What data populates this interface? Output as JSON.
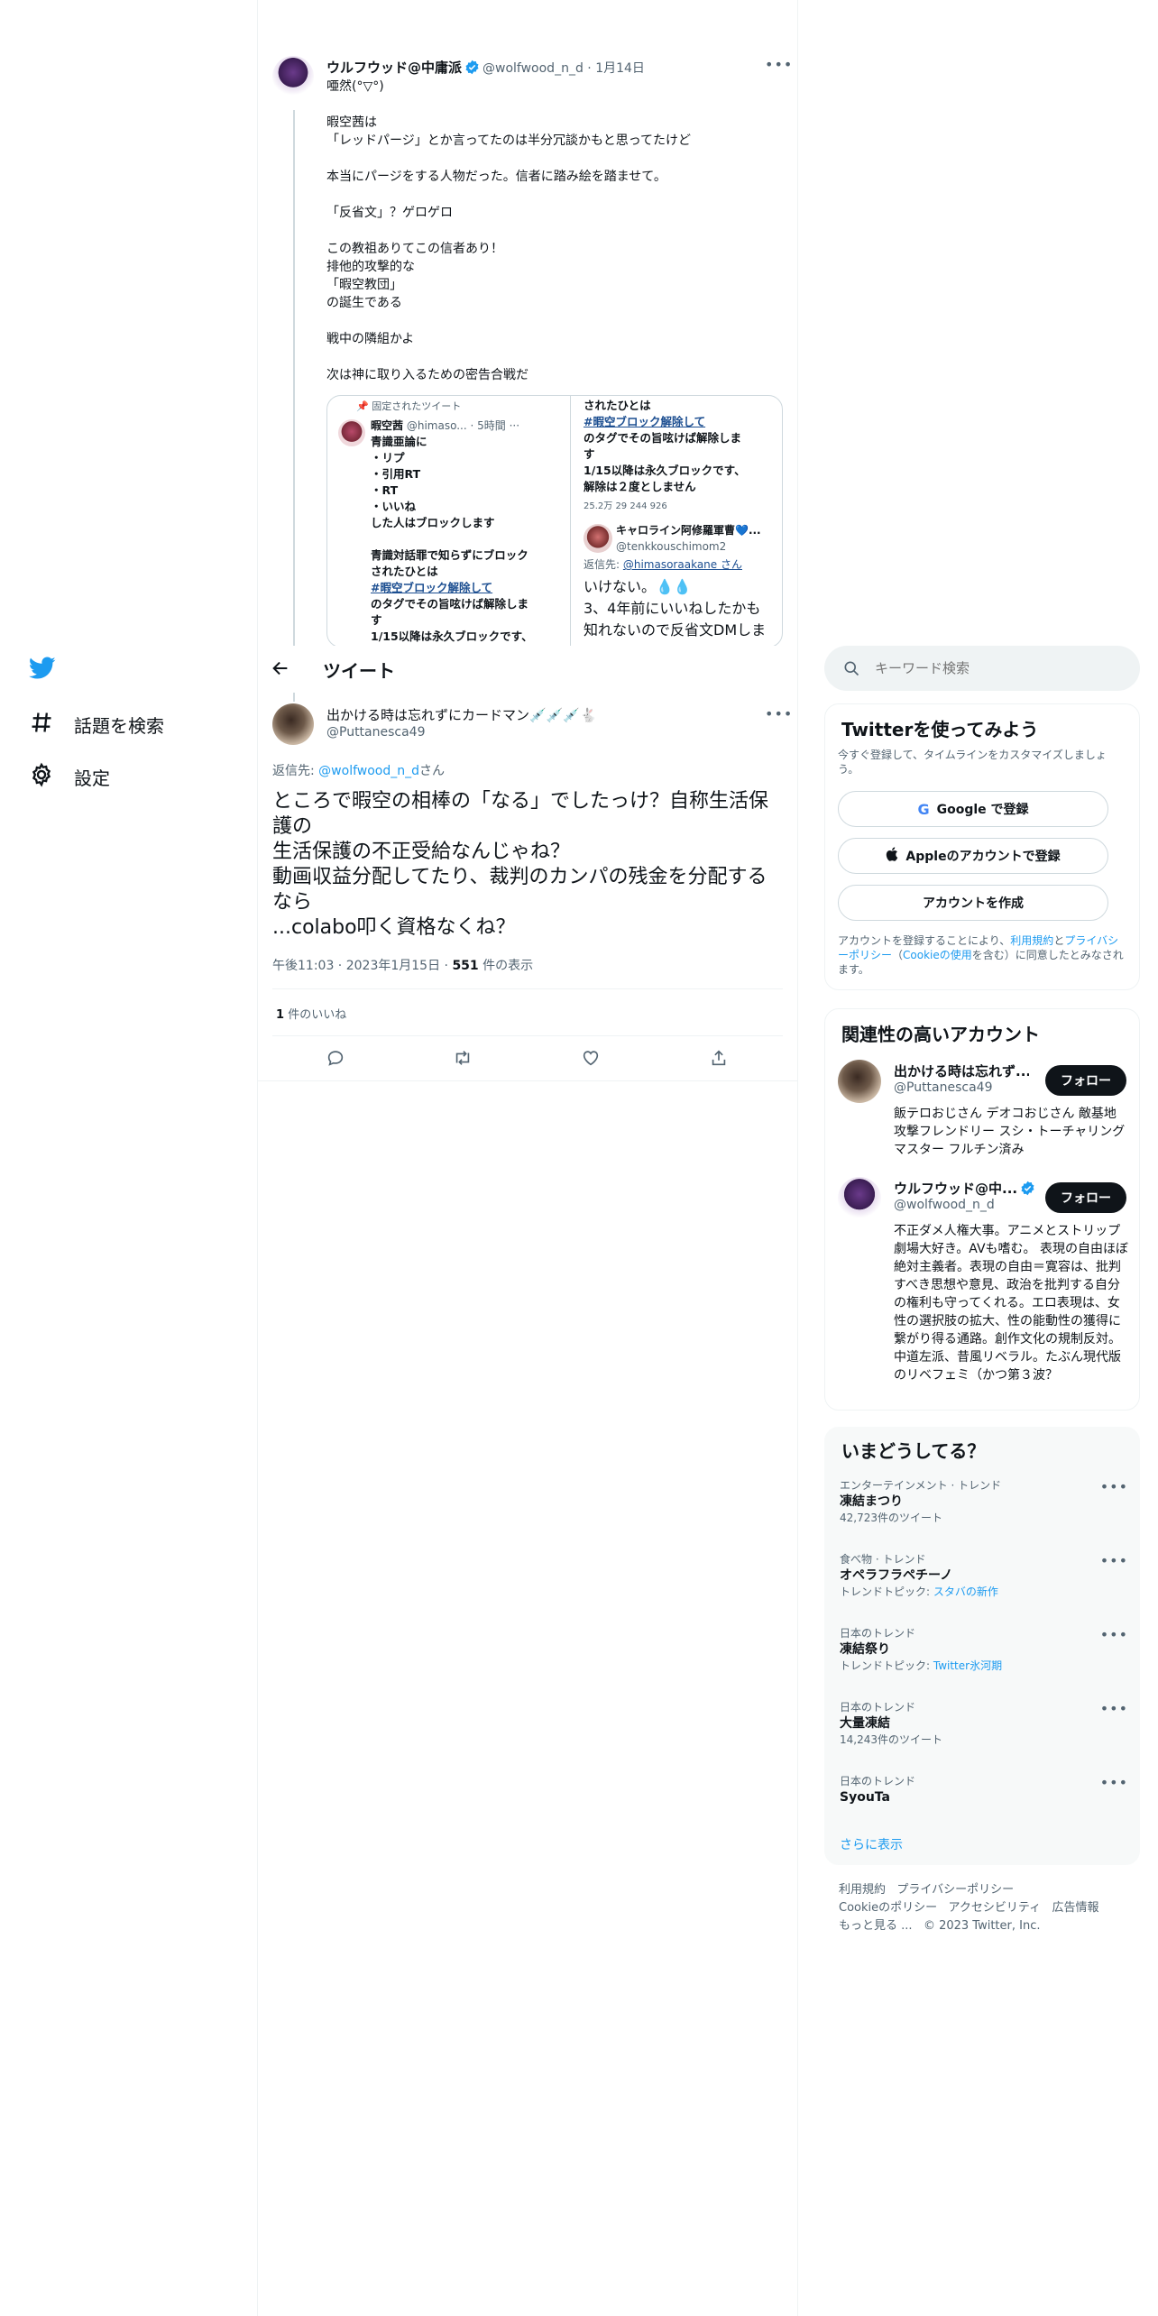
{
  "nav": {
    "explore_label": "話題を検索",
    "settings_label": "設定"
  },
  "parent_tweet": {
    "display_name": "ウルフウッド@中庸派",
    "handle": "@wolfwood_n_d",
    "date": "1月14日",
    "body": "唖然(°▽°)\n\n暇空茜は\n「レッドパージ」とか言ってたのは半分冗談かもと思ってたけど\n\n本当にパージをする人物だった。信者に踏み絵を踏ませて。\n\n「反省文」？ゲロゲロ\n\nこの教祖ありてこの信者あり！\n排他的攻撃的な\n「暇空教団」\nの誕生である\n\n戦中の隣組かよ\n\n次は神に取り入るための密告合戦だ",
    "media": {
      "pinned_label": "固定されたツイート",
      "left_name": "暇空茜",
      "left_handle": "@himaso...",
      "left_time": "5時間",
      "left_lines": [
        "青識亜論に",
        "・リプ",
        "・引用RT",
        "・RT",
        "・いいね",
        "した人はブロックします",
        "",
        "青識対話罪で知らずにブロック",
        "されたひとは"
      ],
      "left_hashtag": "#暇空ブロック解除して",
      "left_tail": [
        "のタグでその旨呟けば解除しま",
        "す",
        "1/15以降は永久ブロックです、"
      ],
      "right_top_lines": [
        "されたひとは"
      ],
      "right_hashtag": "#暇空ブロック解除して",
      "right_lines": [
        "のタグでその旨呟けば解除しま",
        "す",
        "1/15以降は永久ブロックです、",
        "解除は２度としません"
      ],
      "right_stats": "25.2万   29   244   926",
      "reply_name": "キャロライン阿修羅軍曹💙...",
      "reply_handle": "@tenkkouschimom2",
      "reply_to_prefix": "返信先: ",
      "reply_to_handle": "@himasoraakane さん",
      "reply_text_1": "いけない。💧💧",
      "reply_text_2": "3、4年前にいいねしたかも",
      "reply_text_3": "知れないので反省文DMしま"
    }
  },
  "header": {
    "title": "ツイート"
  },
  "main_tweet": {
    "display_name": "出かける時は忘れずにカードマン💉💉💉🐇",
    "handle": "@Puttanesca49",
    "reply_prefix": "返信先: ",
    "reply_handle": "@wolfwood_n_d",
    "reply_suffix": "さん",
    "body": "ところで暇空の相棒の「なる」でしたっけ？自称生活保護の\n生活保護の不正受給なんじゃね？\n動画収益分配してたり、裁判のカンパの残金を分配するなら\n...colabo叩く資格なくね？",
    "time": "午後11:03",
    "date": "2023年1月15日",
    "views_count": "551",
    "views_label": "件の表示",
    "likes_count": "1",
    "likes_label": "件のいいね"
  },
  "search": {
    "placeholder": "キーワード検索"
  },
  "signup": {
    "title": "Twitterを使ってみよう",
    "subtitle": "今すぐ登録して、タイムラインをカスタマイズしましょう。",
    "google_label": "Google で登録",
    "apple_label": "Appleのアカウントで登録",
    "create_label": "アカウントを作成",
    "legal_1": "アカウントを登録することにより、",
    "terms_link": "利用規約",
    "legal_2": "と",
    "privacy_link": "プライバシーポリシー",
    "legal_3": "（",
    "cookie_link": "Cookieの使用",
    "legal_4": "を含む）に同意したとみなされます。"
  },
  "related": {
    "title": "関連性の高いアカウント",
    "follow_label": "フォロー",
    "accounts": [
      {
        "name": "出かける時は忘れず...",
        "handle": "@Puttanesca49",
        "bio": "飯テロおじさん デオコおじさん 敵基地攻撃フレンドリー スシ・トーチャリングマスター フルチン済み"
      },
      {
        "name": "ウルフウッド@中...",
        "handle": "@wolfwood_n_d",
        "bio": "不正ダメ人権大事。アニメとストリップ劇場大好き。AVも嗜む。 表現の自由ほぼ絶対主義者。表現の自由＝寛容は、批判すべき思想や意見、政治を批判する自分の権利も守ってくれる。エロ表現は、女性の選択肢の拡大、性の能動性の獲得に繋がり得る通路。創作文化の規制反対。中道左派、昔風リベラル。たぶん現代版のリベフェミ（かつ第３波？"
      }
    ]
  },
  "trends": {
    "title": "いまどうしてる？",
    "items": [
      {
        "meta": "エンターテインメント · トレンド",
        "name": "凍結まつり",
        "sub_label": "",
        "sub_value": "42,723件のツイート"
      },
      {
        "meta": "食べ物 · トレンド",
        "name": "オペラフラペチーノ",
        "sub_label": "トレンドトピック: ",
        "sub_value": "スタバの新作"
      },
      {
        "meta": "日本のトレンド",
        "name": "凍結祭り",
        "sub_label": "トレンドトピック: ",
        "sub_value": "Twitter氷河期"
      },
      {
        "meta": "日本のトレンド",
        "name": "大量凍結",
        "sub_label": "",
        "sub_value": "14,243件のツイート"
      },
      {
        "meta": "日本のトレンド",
        "name": "SyouTa",
        "sub_label": "",
        "sub_value": ""
      }
    ],
    "show_more": "さらに表示"
  },
  "footer": {
    "terms": "利用規約",
    "privacy": "プライバシーポリシー",
    "cookie": "Cookieのポリシー",
    "accessibility": "アクセシビリティ",
    "ads": "広告情報",
    "more": "もっと見る ...",
    "copyright": "© 2023 Twitter, Inc."
  },
  "colors": {
    "twitter_blue": "#1d9bf0",
    "text": "#0f1419",
    "muted": "#536471",
    "border": "#eff3f4"
  }
}
